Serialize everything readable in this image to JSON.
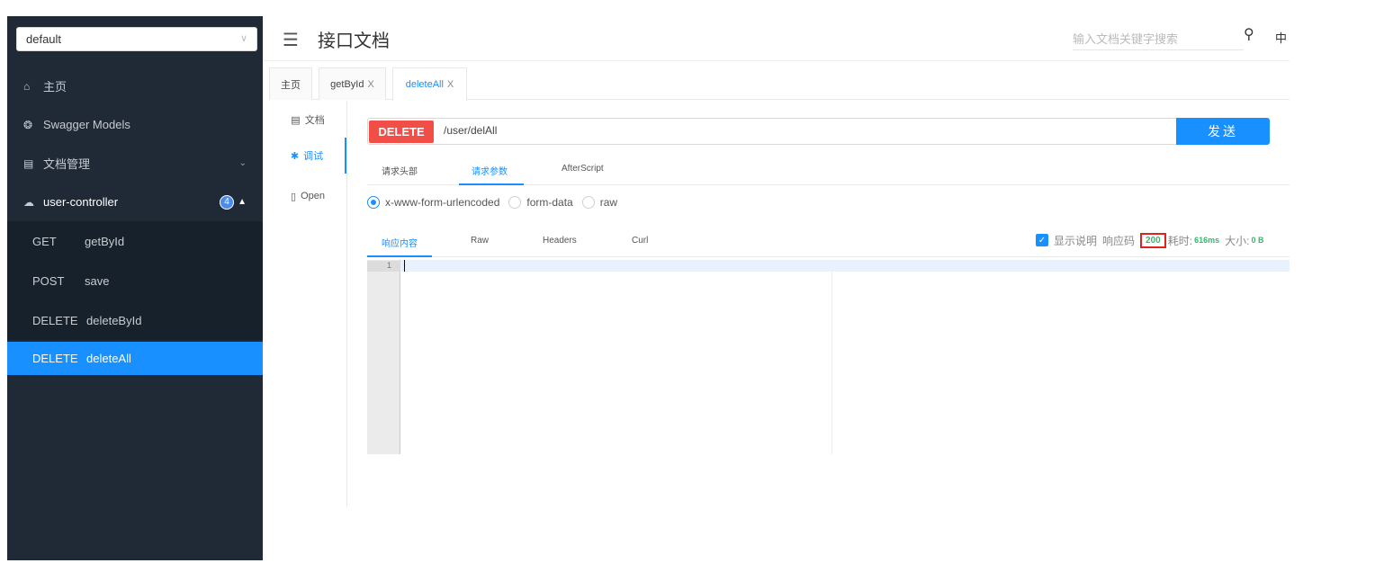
{
  "sidebar": {
    "group_select": "default",
    "menu": [
      {
        "label": "主页"
      },
      {
        "label": "Swagger Models"
      },
      {
        "label": "文档管理"
      },
      {
        "label": "user-controller",
        "badge": "4"
      }
    ],
    "endpoints": [
      {
        "method": "GET",
        "name": "getById"
      },
      {
        "method": "POST",
        "name": "save"
      },
      {
        "method": "DELETE",
        "name": "deleteById"
      },
      {
        "method": "DELETE",
        "name": "deleteAll"
      }
    ]
  },
  "header": {
    "title": "接口文档",
    "search_placeholder": "输入文档关键字搜索",
    "lang": "中"
  },
  "tabs": [
    {
      "label": "主页"
    },
    {
      "label": "getById",
      "close": "X"
    },
    {
      "label": "deleteAll",
      "close": "X"
    }
  ],
  "subnav": [
    {
      "label": "文档"
    },
    {
      "label": "调试"
    },
    {
      "label": "Open"
    }
  ],
  "request": {
    "method": "DELETE",
    "url": "/user/delAll",
    "send_label": "发送",
    "tabs": [
      "请求头部",
      "请求参数",
      "AfterScript"
    ],
    "body_types": [
      "x-www-form-urlencoded",
      "form-data",
      "raw"
    ]
  },
  "response": {
    "tabs": [
      "响应内容",
      "Raw",
      "Headers",
      "Curl"
    ],
    "show_desc_label": "显示说明",
    "code_label": "响应码",
    "code": "200",
    "time_label": "耗时:",
    "time": "616ms",
    "size_label": "大小:",
    "size": "0 B",
    "line_number": "1"
  },
  "colors": {
    "sidebar_bg": "#1f2a36",
    "accent": "#1890ff",
    "delete_method": "#f14e47",
    "status_green": "#3cb371",
    "highlight_box": "#e0231c"
  }
}
